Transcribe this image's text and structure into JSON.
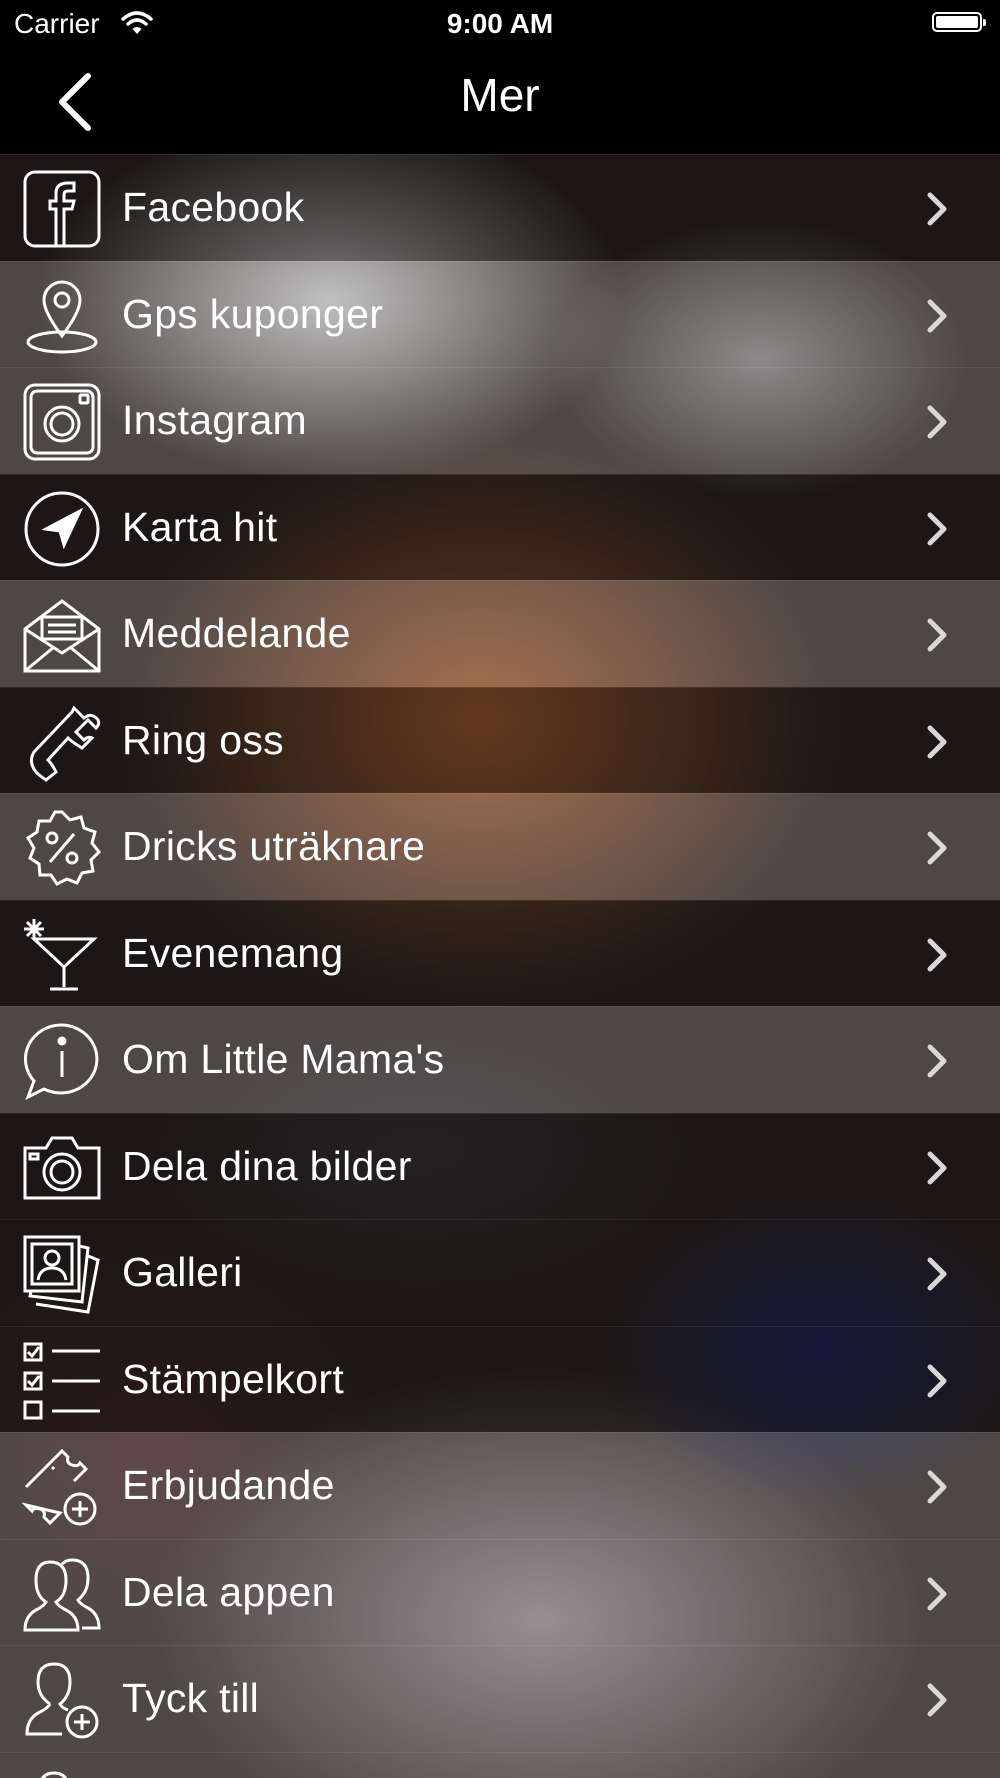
{
  "status_bar": {
    "carrier": "Carrier",
    "time": "9:00 AM",
    "battery_level": 1.0
  },
  "nav": {
    "title": "Mer",
    "back_icon": "chevron-left-icon"
  },
  "menu": {
    "items": [
      {
        "label": "Facebook",
        "icon": "facebook-icon"
      },
      {
        "label": "Gps kuponger",
        "icon": "map-pin-icon"
      },
      {
        "label": "Instagram",
        "icon": "instagram-icon"
      },
      {
        "label": "Karta hit",
        "icon": "navigation-arrow-icon"
      },
      {
        "label": "Meddelande",
        "icon": "envelope-icon"
      },
      {
        "label": "Ring oss",
        "icon": "phone-icon"
      },
      {
        "label": "Dricks uträknare",
        "icon": "percent-badge-icon"
      },
      {
        "label": "Evenemang",
        "icon": "cocktail-icon"
      },
      {
        "label": "Om Little Mama's",
        "icon": "info-bubble-icon"
      },
      {
        "label": "Dela dina bilder",
        "icon": "camera-icon"
      },
      {
        "label": "Galleri",
        "icon": "photo-stack-icon"
      },
      {
        "label": "Stämpelkort",
        "icon": "checklist-icon"
      },
      {
        "label": "Erbjudande",
        "icon": "ticket-plus-icon"
      },
      {
        "label": "Dela appen",
        "icon": "users-icon"
      },
      {
        "label": "Tyck till",
        "icon": "user-plus-icon"
      }
    ],
    "row_arrow_icon": "chevron-right-icon"
  }
}
